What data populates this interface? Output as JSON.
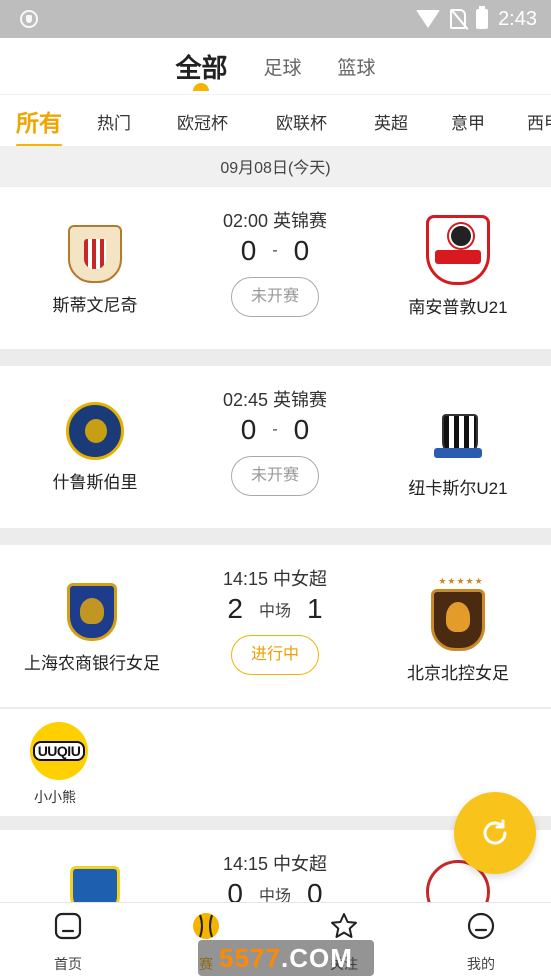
{
  "status_bar": {
    "time": "2:43"
  },
  "top_tabs": [
    {
      "label": "全部",
      "active": true
    },
    {
      "label": "足球",
      "active": false
    },
    {
      "label": "篮球",
      "active": false
    }
  ],
  "league_tabs": [
    {
      "label": "所有",
      "active": true
    },
    {
      "label": "热门"
    },
    {
      "label": "欧冠杯"
    },
    {
      "label": "欧联杯"
    },
    {
      "label": "英超"
    },
    {
      "label": "意甲"
    },
    {
      "label": "西甲"
    }
  ],
  "date_label": "09月08日(今天)",
  "matches": [
    {
      "time_league": "02:00 英锦赛",
      "home": {
        "name": "斯蒂文尼奇",
        "logo": "stevenage-crest-icon"
      },
      "away": {
        "name": "南安普敦U21",
        "logo": "southampton-crest-icon"
      },
      "home_score": "0",
      "away_score": "0",
      "separator": "-",
      "status": "未开赛"
    },
    {
      "time_league": "02:45 英锦赛",
      "home": {
        "name": "什鲁斯伯里",
        "logo": "shrewsbury-crest-icon"
      },
      "away": {
        "name": "纽卡斯尔U21",
        "logo": "newcastle-crest-icon"
      },
      "home_score": "0",
      "away_score": "0",
      "separator": "-",
      "status": "未开赛"
    },
    {
      "time_league": "14:15 中女超",
      "home": {
        "name": "上海农商银行女足",
        "logo": "shanghai-crest-icon"
      },
      "away": {
        "name": "北京北控女足",
        "logo": "beijing-crest-icon"
      },
      "home_score": "2",
      "away_score": "1",
      "separator": "中场",
      "status": "进行中"
    },
    {
      "time_league": "14:15 中女超",
      "home_score": "0",
      "away_score": "0",
      "separator": "中场"
    }
  ],
  "sponsor": {
    "logo_text": "UUQIU",
    "name": "小小熊"
  },
  "bottom_nav": [
    {
      "label": "首页",
      "icon": "home-icon"
    },
    {
      "label": "赛",
      "icon": "ball-icon",
      "active": true
    },
    {
      "label": "关注",
      "icon": "star-icon"
    },
    {
      "label": "我的",
      "icon": "profile-icon"
    }
  ],
  "watermark": {
    "num": "5577",
    "suffix": ".COM"
  },
  "colors": {
    "accent": "#f4b400",
    "live": "#e8a000",
    "status_bar": "#bdbdbd"
  }
}
